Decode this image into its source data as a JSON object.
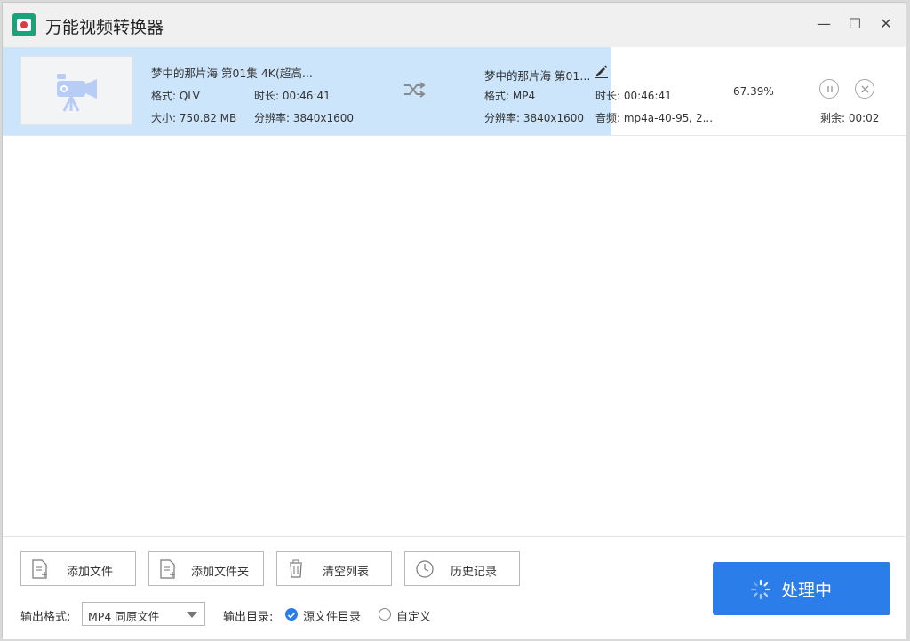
{
  "app": {
    "title": "万能视频转换器",
    "accent_color": "#2b7de9",
    "icon_color": "#1aa37b"
  },
  "window_controls": {
    "minimize": "—",
    "maximize": "☐",
    "close": "✕"
  },
  "file": {
    "source": {
      "name": "梦中的那片海 第01集 4K(超高...",
      "format": "格式: QLV",
      "duration": "时长: 00:46:41",
      "size": "大小: 750.82 MB",
      "resolution": "分辨率: 3840x1600"
    },
    "target": {
      "name": "梦中的那片海 第01...",
      "format": "格式: MP4",
      "duration": "时长: 00:46:41",
      "resolution": "分辨率: 3840x1600",
      "audio": "音频: mp4a-40-95, 2..."
    },
    "progress_text": "67.39%",
    "progress_percent": 67.39,
    "remaining": "剩余: 00:02",
    "icons": {
      "thumbnail": "video-camera-icon",
      "swap": "shuffle-icon",
      "edit": "pencil-icon",
      "pause": "pause-icon",
      "cancel": "close-circle-icon"
    }
  },
  "toolbar": {
    "add_file": "添加文件",
    "add_folder": "添加文件夹",
    "clear_list": "清空列表",
    "history": "历史记录"
  },
  "output": {
    "format_label": "输出格式:",
    "format_value": "MP4 同原文件",
    "dir_label": "输出目录:",
    "dir_source": "源文件目录",
    "dir_custom": "自定义",
    "selected_dir": "源文件目录"
  },
  "process_button": "处理中"
}
